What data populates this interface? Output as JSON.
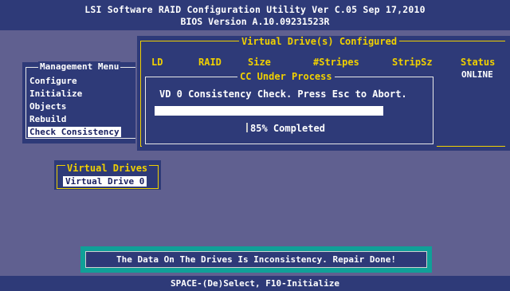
{
  "title_bar": {
    "line1": "LSI Software RAID Configuration Utility Ver C.05 Sep 17,2010",
    "line2": "BIOS Version  A.10.09231523R"
  },
  "management_menu": {
    "title": "Management Menu",
    "items": [
      "Configure",
      "Initialize",
      "Objects",
      "Rebuild",
      "Check Consistency"
    ],
    "selected_index": 4
  },
  "virtual_drives_configured": {
    "title": "Virtual Drive(s) Configured",
    "columns": [
      "LD",
      "RAID",
      "Size",
      "#Stripes",
      "StripSz",
      "Status"
    ],
    "rows": [
      {
        "status": "ONLINE"
      }
    ]
  },
  "cc_dialog": {
    "title": "CC Under Process",
    "message": "VD 0 Consistency Check. Press Esc to Abort.",
    "progress": 0.85,
    "progress_text": "85% Completed"
  },
  "virtual_drives": {
    "title": "Virtual Drives",
    "items": [
      "Virtual Drive 0"
    ]
  },
  "message_box": {
    "text": "The Data On The Drives Is Inconsistency. Repair Done!"
  },
  "status_bar": {
    "text": "SPACE-(De)Select, F10-Initialize"
  },
  "colors": {
    "background": "#606090",
    "panel": "#2e3a78",
    "accent_yellow": "#f0d000",
    "message_teal": "#10a098"
  }
}
